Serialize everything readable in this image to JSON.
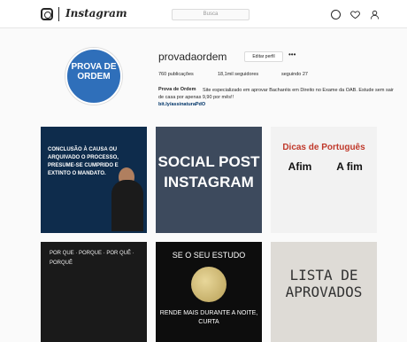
{
  "header": {
    "app_name": "Instagram",
    "search_placeholder": "Busca",
    "icons": [
      "instagram-logo-icon",
      "compass-icon",
      "heart-icon",
      "user-icon"
    ]
  },
  "profile": {
    "avatar_text": "PROVA DE ORDEM",
    "username": "provadaordem",
    "edit_label": "Editar perfil",
    "more_label": "•••",
    "stats": {
      "posts": "760 publicações",
      "followers": "18,1mil seguidores",
      "following": "seguindo 27"
    },
    "bio_name": "Prova de Ordem",
    "bio_text": "Site especializado em aprovar Bacharéis em Direito no Exame da OAB. Estude sem sair de casa por apenas 9,90 por mês!!",
    "bio_link": "bit.ly/assinaturaPdO"
  },
  "posts": [
    {
      "text": "CONCLUSÃO À CAUSA OU ARQUIVADO O PROCESSO, PRESUME-SE CUMPRIDO E EXTINTO O MANDATO."
    },
    {
      "text": "SOCIAL POST INSTAGRAM"
    },
    {
      "header": "Dicas de Português",
      "left": "Afim",
      "right": "A fim"
    },
    {
      "text": "POR QUE · PORQUE · POR QUÊ · PORQUÊ"
    },
    {
      "top": "SE O SEU ESTUDO",
      "bottom": "RENDE MAIS DURANTE A NOITE, CURTA"
    },
    {
      "text": "LISTA DE APROVADOS"
    }
  ],
  "colors": {
    "accent": "#003569",
    "brand": "#2f6fba",
    "placeholder_tile": "#3d4a5d"
  }
}
